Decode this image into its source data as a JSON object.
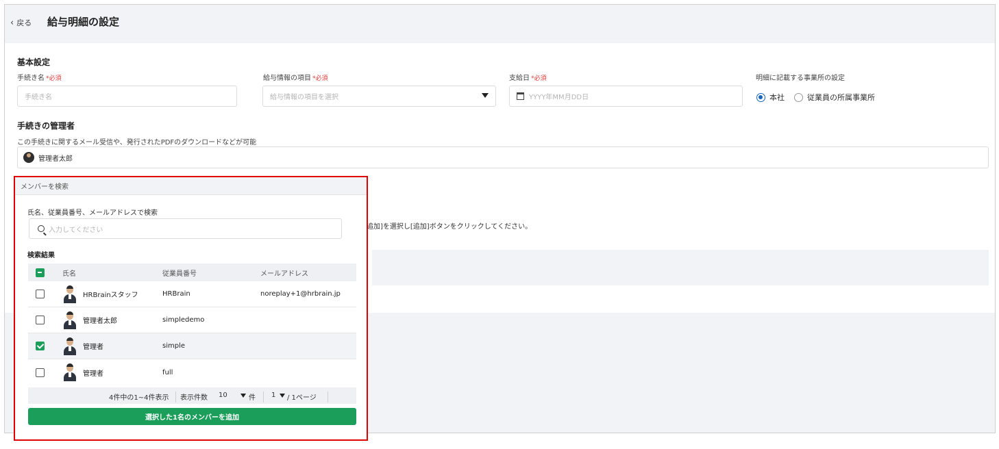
{
  "header": {
    "back_label": "戻る",
    "title": "給与明細の設定"
  },
  "basic": {
    "title": "基本設定",
    "proc_name_label": "手続き名",
    "required": "*必須",
    "proc_name_placeholder": "手続き名",
    "salary_item_label": "給与情報の項目",
    "salary_item_placeholder": "給与情報の項目を選択",
    "pay_date_label": "支給日",
    "pay_date_placeholder": "YYYY年MM月DD日",
    "office_label": "明細に記載する事業所の設定",
    "office_options": [
      "本社",
      "従業員の所属事業所"
    ],
    "office_selected": "本社"
  },
  "admin": {
    "title": "手続きの管理者",
    "desc": "この手続きに関するメール受信や、発行されたPDFのダウンロードなどが可能",
    "selected_name": "管理者太郎"
  },
  "background": {
    "partial_text": "追加]を選択し[追加]ボタンをクリックしてください。"
  },
  "popup": {
    "title": "メンバーを検索",
    "search_label": "氏名、従業員番号、メールアドレスで検索",
    "search_placeholder": "入力してください",
    "results_label": "検索結果",
    "columns": {
      "name": "氏名",
      "emp": "従業員番号",
      "mail": "メールアドレス"
    },
    "rows": [
      {
        "name": "HRBrainスタッフ",
        "emp": "HRBrain",
        "mail": "noreplay+1@hrbrain.jp",
        "checked": false
      },
      {
        "name": "管理者太郎",
        "emp": "simpledemo",
        "mail": "",
        "checked": false
      },
      {
        "name": "管理者",
        "emp": "simple",
        "mail": "",
        "checked": true
      },
      {
        "name": "管理者",
        "emp": "full",
        "mail": "",
        "checked": false
      }
    ],
    "pager": {
      "summary": "4件中の1~4件表示",
      "per_page_label": "表示件数",
      "per_page_value": "10",
      "per_page_unit": "件",
      "page_value": "1",
      "page_total": "/ 1ページ"
    },
    "add_button": "選択した1名のメンバーを追加"
  },
  "colors": {
    "accent_green": "#1a9e5a",
    "highlight_red": "#e00000",
    "radio_blue": "#1565c0",
    "required_red": "#e53935"
  }
}
